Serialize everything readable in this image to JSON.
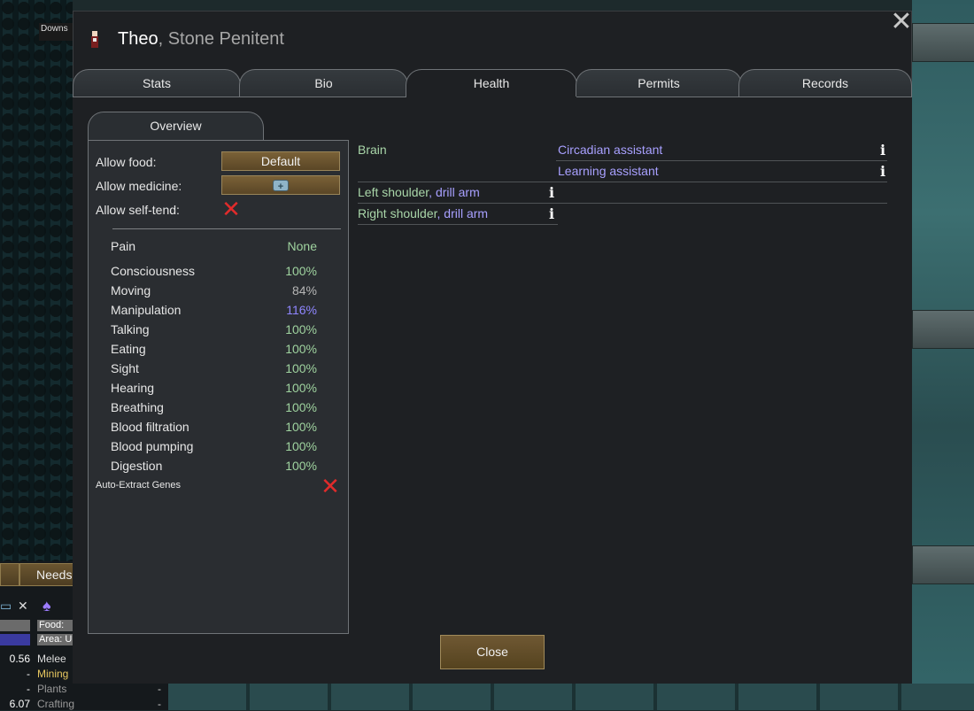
{
  "background": {
    "downs_label": "Downs",
    "needs_button": "Needs",
    "food_tag": "Food:",
    "area_tag": "Area: U",
    "skills": [
      {
        "value": "0.56",
        "label": "Melee",
        "dash": "-"
      },
      {
        "value": "-",
        "label": "Mining",
        "dash": "-"
      },
      {
        "value": "-",
        "label": "Plants",
        "dash": "-"
      },
      {
        "value": "6.07",
        "label": "Crafting",
        "dash": "-"
      }
    ]
  },
  "dialog": {
    "name": "Theo",
    "separator": ", ",
    "subtitle": "Stone Penitent",
    "close_x": "✕",
    "tabs": [
      "Stats",
      "Bio",
      "Health",
      "Permits",
      "Records"
    ],
    "active_tab": "Health",
    "subtab": "Overview",
    "settings": {
      "allow_food_label": "Allow food:",
      "allow_food_value": "Default",
      "allow_medicine_label": "Allow medicine:",
      "allow_self_tend_label": "Allow self-tend:"
    },
    "pain": {
      "name": "Pain",
      "value": "None"
    },
    "capacities": [
      {
        "name": "Consciousness",
        "value": "100%",
        "color": "#9fd39f"
      },
      {
        "name": "Moving",
        "value": "84%",
        "color": "#b5b5b5"
      },
      {
        "name": "Manipulation",
        "value": "116%",
        "color": "#8f86ff"
      },
      {
        "name": "Talking",
        "value": "100%",
        "color": "#9fd39f"
      },
      {
        "name": "Eating",
        "value": "100%",
        "color": "#9fd39f"
      },
      {
        "name": "Sight",
        "value": "100%",
        "color": "#9fd39f"
      },
      {
        "name": "Hearing",
        "value": "100%",
        "color": "#9fd39f"
      },
      {
        "name": "Breathing",
        "value": "100%",
        "color": "#9fd39f"
      },
      {
        "name": "Blood filtration",
        "value": "100%",
        "color": "#9fd39f"
      },
      {
        "name": "Blood pumping",
        "value": "100%",
        "color": "#9fd39f"
      },
      {
        "name": "Digestion",
        "value": "100%",
        "color": "#9fd39f"
      }
    ],
    "auto_extract_label": "Auto-Extract Genes",
    "health_rows": [
      {
        "part": "Brain",
        "part_mod": "",
        "hediffs": [
          "Circadian assistant",
          "Learning assistant"
        ]
      },
      {
        "part": "Left shoulder",
        "part_mod": ", drill arm",
        "hediffs": []
      },
      {
        "part": "Right shoulder",
        "part_mod": ", drill arm",
        "hediffs": []
      }
    ],
    "info_glyph": "i",
    "close_button": "Close"
  },
  "colors": {
    "panel": "#1e2023",
    "tab_border": "#6f7377",
    "wood_button": "#6f5833",
    "body_part_green": "#a9d6a9",
    "hediff_purple": "#a8a0ff",
    "red_x": "#e02b2b"
  },
  "icons": [
    "close-icon",
    "pawn-portrait-icon",
    "medicine-icon",
    "disallowed-x-icon",
    "info-icon"
  ]
}
